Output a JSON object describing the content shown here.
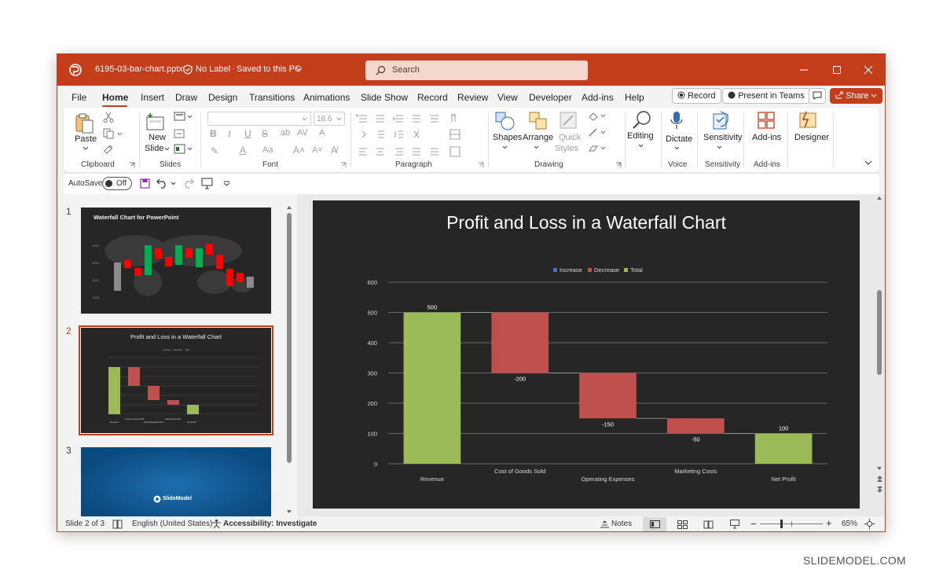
{
  "window": {
    "filename": "6195-03-bar-chart.pptx",
    "label_status": "No Label",
    "save_status": "Saved to this PC",
    "search_placeholder": "Search"
  },
  "menu": {
    "tabs": [
      "File",
      "Home",
      "Insert",
      "Draw",
      "Design",
      "Transitions",
      "Animations",
      "Slide Show",
      "Record",
      "Review",
      "View",
      "Developer",
      "Add-ins",
      "Help"
    ],
    "active_tab": "Home",
    "record_button": "Record",
    "present_teams_button": "Present in Teams",
    "share_button": "Share"
  },
  "ribbon": {
    "clipboard": {
      "paste": "Paste",
      "group": "Clipboard"
    },
    "slides": {
      "new_slide_1": "New",
      "new_slide_2": "Slide",
      "group": "Slides"
    },
    "font": {
      "size": "18.6",
      "group": "Font"
    },
    "paragraph": {
      "group": "Paragraph"
    },
    "drawing": {
      "shapes": "Shapes",
      "arrange": "Arrange",
      "quick_styles_1": "Quick",
      "quick_styles_2": "Styles",
      "group": "Drawing"
    },
    "editing": {
      "label": "Editing"
    },
    "voice": {
      "dictate": "Dictate",
      "group": "Voice"
    },
    "sensitivity": {
      "label": "Sensitivity",
      "group": "Sensitivity"
    },
    "addins": {
      "label": "Add-ins",
      "group": "Add-ins"
    },
    "designer": {
      "label": "Designer"
    }
  },
  "qat": {
    "autosave_label": "AutoSave",
    "autosave_state": "Off"
  },
  "thumbnails": [
    {
      "number": "1",
      "title": "Waterfall Chart for PowerPoint"
    },
    {
      "number": "2",
      "title": "Profit and Loss in a Waterfall Chart",
      "selected": true
    },
    {
      "number": "3",
      "logo": "SlideModel"
    }
  ],
  "thumb2": {
    "legend": [
      "Increase",
      "Decrease",
      "Total"
    ],
    "xlabels": [
      "Revenue",
      "Cost of Goods Sold",
      "Operating Expenses",
      "Marketing Costs",
      "Net Profit"
    ]
  },
  "thumb3": {
    "logo_text": "SlideModel"
  },
  "chart_data": {
    "type": "waterfall",
    "title": "Profit and Loss in a Waterfall Chart",
    "categories": [
      "Revenue",
      "Cost of Goods Sold",
      "Operating Expenses",
      "Marketing Costs",
      "Net Profit"
    ],
    "values": [
      500,
      -200,
      -150,
      -50,
      100
    ],
    "kinds": [
      "total",
      "decrease",
      "decrease",
      "decrease",
      "total"
    ],
    "data_labels": [
      "500",
      "-200",
      "-150",
      "-50",
      "100"
    ],
    "legend": [
      {
        "name": "Increase",
        "color": "#4472c4"
      },
      {
        "name": "Decrease",
        "color": "#c0504d"
      },
      {
        "name": "Total",
        "color": "#9bbb59"
      }
    ],
    "legend_position": "top",
    "ylim": [
      0,
      600
    ],
    "yticks": [
      0,
      100,
      200,
      300,
      400,
      500,
      600
    ],
    "grid": true,
    "colors": {
      "total": "#9bbb59",
      "decrease": "#c0504d",
      "increase": "#4472c4",
      "background": "#262626"
    }
  },
  "status": {
    "slide_indicator": "Slide 2 of 3",
    "language": "English (United States)",
    "accessibility": "Accessibility: Investigate",
    "notes": "Notes",
    "zoom": "65%"
  },
  "colors": {
    "accent": "#c43e1c",
    "search_bg": "#f4d8d0"
  },
  "credit": "SLIDEMODEL.COM"
}
